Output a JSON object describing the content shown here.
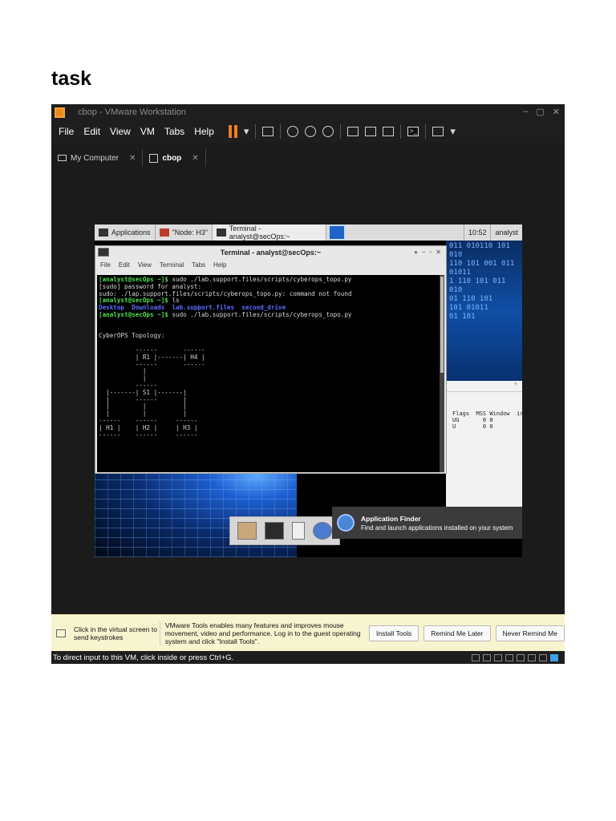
{
  "page": {
    "heading": "task"
  },
  "window": {
    "title": "cbop - VMware Workstation",
    "controls": [
      "–",
      "▢",
      "✕"
    ]
  },
  "menubar": {
    "items": [
      "File",
      "Edit",
      "View",
      "VM",
      "Tabs",
      "Help"
    ]
  },
  "tabs": [
    {
      "label": "My Computer",
      "close": "✕"
    },
    {
      "label": "cbop",
      "close": "✕"
    }
  ],
  "guest": {
    "panel": {
      "applications": "Applications",
      "node_window": "\"Node: H3\"",
      "terminal_window": "Terminal - analyst@secOps:~",
      "time": "10:52",
      "user": "analyst"
    },
    "terminal": {
      "title": "Terminal - analyst@secOps:~",
      "menu": [
        "File",
        "Edit",
        "View",
        "Terminal",
        "Tabs",
        "Help"
      ],
      "lines": [
        {
          "prompt": "[analyst@secOps ~]$",
          "text": " sudo ./lab.support.files/scripts/cyberops_topo.py"
        },
        {
          "text": "[sudo] password for analyst:"
        },
        {
          "text": "sudo: ./lap.support.files/scripts/cyberops_topo.py: command not found"
        },
        {
          "prompt": "[analyst@secOps ~]$",
          "text": " ls"
        },
        {
          "dirs": "Desktop  Downloads  lab.support.files  second_drive"
        },
        {
          "prompt": "[analyst@secOps ~]$",
          "text": " sudo ./lab.support.files/scripts/cyberops_topo.py"
        },
        {
          "text": ""
        },
        {
          "text": ""
        },
        {
          "text": "CyberOPS Topology:"
        },
        {
          "text": ""
        },
        {
          "text": "          ------       ------"
        },
        {
          "text": "          | R1 |-------| H4 |"
        },
        {
          "text": "          ------       ------"
        },
        {
          "text": "            |"
        },
        {
          "text": "            |"
        },
        {
          "text": "          ------"
        },
        {
          "text": "  |-------| S1 |-------|"
        },
        {
          "text": "  |       ------       |"
        },
        {
          "text": "  |         |          |"
        },
        {
          "text": "  |         |          |"
        },
        {
          "text": "------    ------     ------"
        },
        {
          "text": "| H1 |    | H2 |     | H3 |"
        },
        {
          "text": "------    ------     ------"
        }
      ]
    },
    "background_code": [
      "011 010110 101 010",
      "110 101 001 011",
      "",
      "  01011",
      "",
      "1 110 101 011 010",
      "      01 110 101",
      "",
      "",
      "  101 01011",
      "",
      "01 101"
    ],
    "bg_window": {
      "header": "+",
      "columns": "Flags  MSS Window  ir\nUG       0 0\nU        0 0"
    },
    "app_finder": {
      "title": "Application Finder",
      "description": "Find and launch applications installed on your system"
    }
  },
  "notice": {
    "click_hint": "Click in the virtual screen to send keystrokes",
    "tools_message": "VMware Tools enables many features and improves mouse movement, video and performance. Log in to the guest operating system and click \"Install Tools\".",
    "install_button": "Install Tools",
    "remind_later_button": "Remind Me Later",
    "never_remind_button": "Never Remind Me"
  },
  "status": {
    "text": "To direct input to this VM, click inside or press Ctrl+G."
  }
}
